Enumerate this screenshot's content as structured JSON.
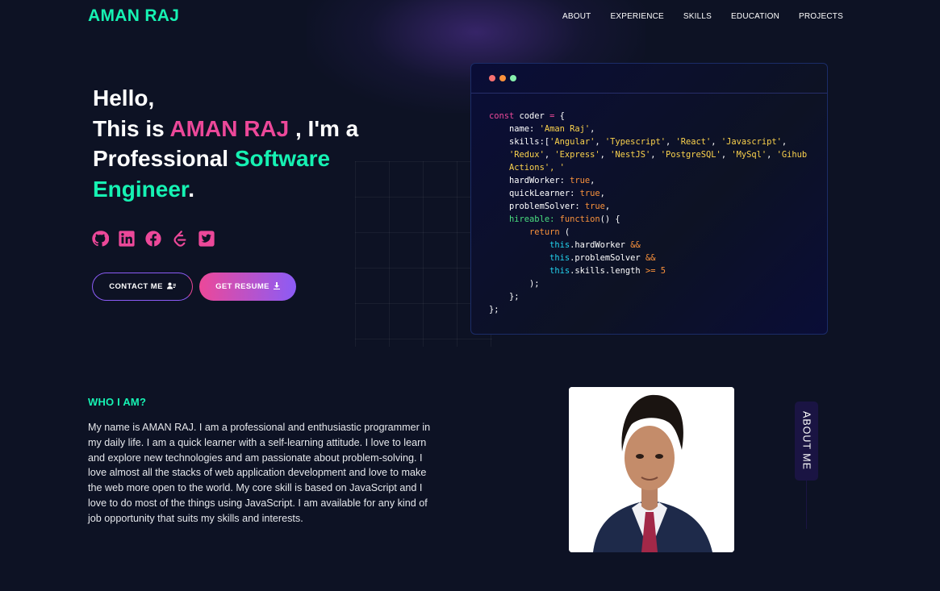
{
  "nav": {
    "logo": "AMAN RAJ",
    "links": [
      "ABOUT",
      "EXPERIENCE",
      "SKILLS",
      "EDUCATION",
      "PROJECTS"
    ]
  },
  "hero": {
    "hello": "Hello,",
    "this_is": "This is ",
    "name": "AMAN RAJ",
    "im_a": " , I'm a",
    "professional": "Professional ",
    "software": "Software",
    "engineer": "Engineer",
    "period": "."
  },
  "social": [
    "github-icon",
    "linkedin-icon",
    "facebook-icon",
    "leetcode-icon",
    "twitter-icon"
  ],
  "buttons": {
    "contact": "CONTACT ME",
    "resume": "GET RESUME"
  },
  "code": {
    "l1_kw": "const",
    "l1_var": " coder ",
    "l1_op": "=",
    "l1_brace": " {",
    "name_key": "name: ",
    "name_val": "'Aman Raj'",
    "name_end": ",",
    "skills_key": "skills:[",
    "skill_items_line1": [
      "'Angular'",
      "'Typescript'",
      "'React'",
      "'Javascript'"
    ],
    "skill_items_line2": [
      "'Redux'",
      "'Express'",
      "'NestJS'",
      "'PostgreSQL'",
      "'MySql'",
      "'Gihub"
    ],
    "skill_items_line3": "Actions'",
    "skill_tail": ", '",
    "hard_key": "hardWorker: ",
    "bool_true": "true",
    "quick_key": "quickLearner: ",
    "solver_key": "problemSolver: ",
    "hire_key": "hireable: ",
    "func_kw": "function",
    "func_rest": "() {",
    "return_kw": "return",
    "return_paren": " (",
    "this_kw": "this",
    "hw_prop": ".hardWorker ",
    "and_op": "&&",
    "ps_prop": ".problemSolver ",
    "len_prop": ".skills.length ",
    "gte_op": ">=",
    "five": " 5",
    "close_paren": ");",
    "close_fn": "};",
    "close_obj": "};"
  },
  "about": {
    "heading": "WHO I AM?",
    "text": "My name is AMAN RAJ. I am a professional and enthusiastic programmer in my daily life. I am a quick learner with a self-learning attitude. I love to learn and explore new technologies and am passionate about problem-solving. I love almost all the stacks of web application development and love to make the web more open to the world. My core skill is based on JavaScript and I love to do most of the things using JavaScript. I am available for any kind of job opportunity that suits my skills and interests.",
    "side_label": "ABOUT ME"
  },
  "colors": {
    "background": "#0d1224",
    "accent_green": "#16f2b3",
    "accent_pink": "#ec4899",
    "accent_purple": "#8b5cf6"
  }
}
